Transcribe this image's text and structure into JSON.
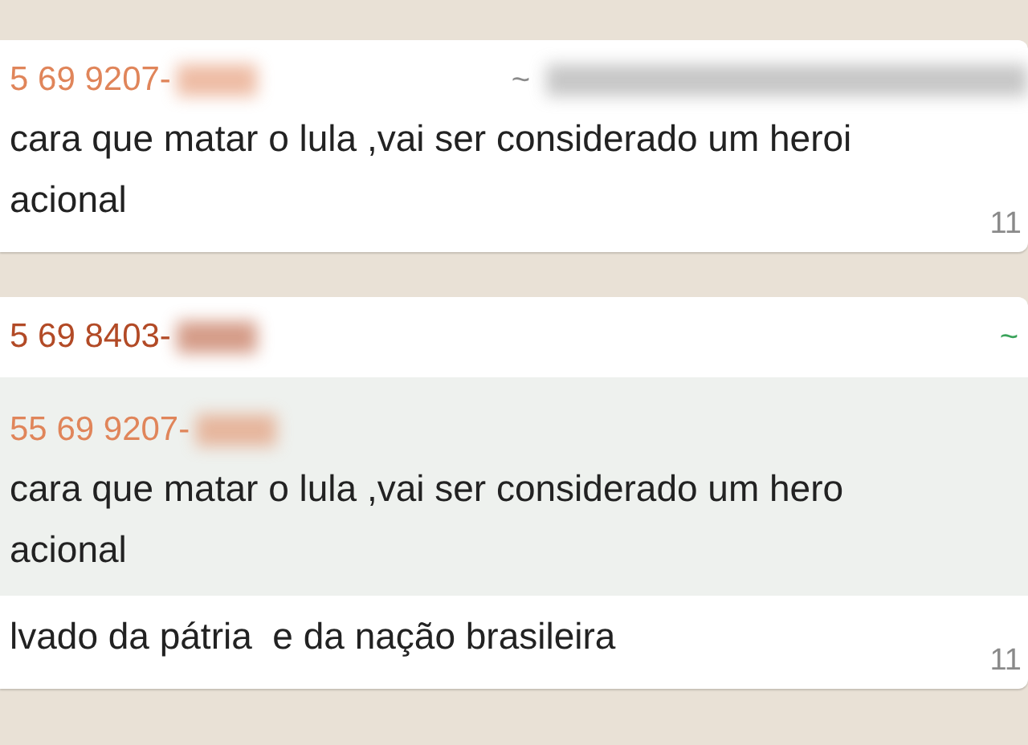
{
  "messages": [
    {
      "sender": "5 69 9207-",
      "color": "#e0855a",
      "lines": [
        "cara que matar o lula ,vai ser considerado um heroi",
        "acional"
      ],
      "time": "11",
      "author": {
        "mark": "~",
        "color": "#8a8a8a"
      }
    },
    {
      "sender": "5 69 8403-",
      "color": "#b24a26",
      "quote": {
        "sender": "55 69 9207-",
        "color": "#e0855a",
        "lines": [
          "cara que matar o lula ,vai ser considerado um hero",
          "acional"
        ]
      },
      "lines": [
        "lvado da pátria  e da nação brasileira"
      ],
      "time": "11",
      "author": {
        "mark": "~",
        "color": "#3aa35a"
      }
    }
  ]
}
